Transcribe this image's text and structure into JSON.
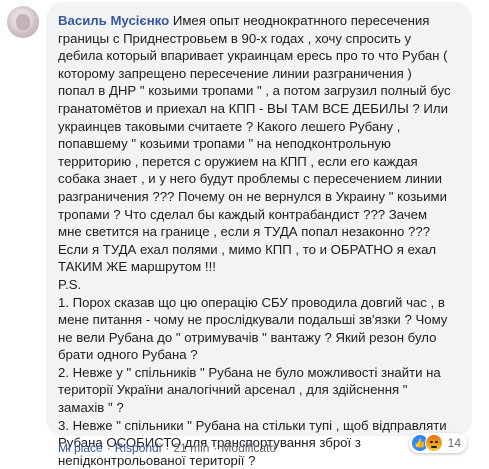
{
  "comment": {
    "author": "Василь Мусієнко",
    "lines": [
      "Имея опыт неоднократнного пересечения",
      "границы с Приднестровьем в 90-х годах , хочу спросить у",
      "дебила который впаривает украинцам ересь про то что Рубан (",
      "которому запрещено пересечение линии разграничения )",
      "попал в ДНР \" козьими тропами \" , а потом загрузил полный бус",
      "гранатомётов и приехал на КПП - ВЫ ТАМ ВСЕ ДЕБИЛЫ ? Или",
      "украинцев таковыми считаете ? Какого лешего Рубану ,",
      "попавшему \" козьими тропами \" на неподконтрольную",
      "территорию , перется с оружием на КПП , если его каждая",
      "собака знает , и у него будут проблемы с пересечением линии",
      "разграничения ??? Почему он не вернулся в Украину \" козьими",
      "тропами ? Что сделал бы каждый контрабандист ??? Зачем",
      "мне светится на границе , если я ТУДА попал незаконно ???",
      "Если я ТУДА ехал полями , мимо КПП , то и ОБРАТНО я ехал",
      "ТАКИМ ЖЕ маршрутом !!!",
      "P.S.",
      "1. Порох сказав що цю операцію СБУ проводила довгий час , в",
      "мене питання - чому не прослідкували подальші зв'язки ? Чому",
      "не вели Рубана до \" отримувачів \" вантажу ? Який резон було",
      "брати одного Рубана ?",
      "2. Невже у \" спільників \" Рубана не було можливості знайти на",
      "території України аналогічний арсенал , для здійснення \"",
      "замахів \" ?",
      "3. Невже \" спільники \" Рубана на стільки тупі , щоб відправляти",
      "Рубана ОСОБИСТО для транспортування зброї з",
      "непідконтрольованої території ?"
    ]
  },
  "actions": {
    "like": "Mi piace",
    "reply": "Rispondi",
    "time": "21 min",
    "edited": "Modificato",
    "separator": "·"
  },
  "reactions": {
    "icons": [
      "like-icon",
      "angry-icon"
    ],
    "count": "14",
    "colors": {
      "like": "#2d88ff",
      "angry": "#e9710f",
      "link": "#385898",
      "bubble": "#f2f3f5"
    }
  }
}
